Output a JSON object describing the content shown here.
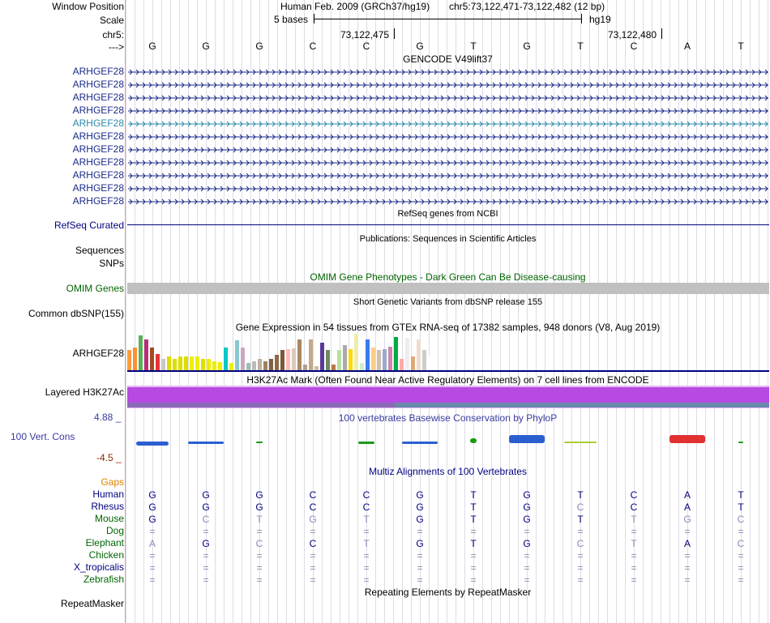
{
  "ruler": {
    "window_position_label": "Window Position",
    "scale_label": "Scale",
    "chr_label": "chr5:",
    "arrow_label": "--->",
    "assembly": "Human Feb. 2009 (GRCh37/hg19)",
    "position": "chr5:73,122,471-73,122,482 (12 bp)",
    "scale_text": "5 bases",
    "db": "hg19",
    "coord1": "73,122,475",
    "coord2": "73,122,480",
    "bases": [
      "G",
      "G",
      "G",
      "C",
      "C",
      "G",
      "T",
      "G",
      "T",
      "C",
      "A",
      "T"
    ]
  },
  "gencode": {
    "title": "GENCODE V49lift37",
    "genes": [
      "ARHGEF28",
      "ARHGEF28",
      "ARHGEF28",
      "ARHGEF28",
      "ARHGEF28",
      "ARHGEF28",
      "ARHGEF28",
      "ARHGEF28",
      "ARHGEF28",
      "ARHGEF28",
      "ARHGEF28"
    ],
    "highlight_index": 4
  },
  "refseq": {
    "title": "RefSeq genes from NCBI",
    "label": "RefSeq Curated"
  },
  "pubs": {
    "title": "Publications: Sequences in Scientific Articles",
    "label1": "Sequences",
    "label2": "SNPs"
  },
  "omim": {
    "title": "OMIM Gene Phenotypes - Dark Green Can Be Disease-causing",
    "label": "OMIM Genes"
  },
  "dbsnp": {
    "title": "Short Genetic Variants from dbSNP release 155",
    "label": "Common dbSNP(155)"
  },
  "gtex": {
    "title": "Gene Expression in 54 tissues from GTEx RNA-seq of 17382 samples, 948 donors (V8, Aug 2019)",
    "label": "ARHGEF28",
    "levels": [
      0.55,
      0.62,
      0.95,
      0.85,
      0.62,
      0.45,
      0.3,
      0.38,
      0.3,
      0.38,
      0.38,
      0.38,
      0.38,
      0.3,
      0.32,
      0.25,
      0.22,
      0.62,
      0.2,
      0.82,
      0.62,
      0.2,
      0.25,
      0.3,
      0.25,
      0.3,
      0.42,
      0.55,
      0.58,
      0.6,
      0.85,
      0.15,
      0.85,
      0.12,
      0.75,
      0.55,
      0.15,
      0.55,
      0.68,
      0.58,
      1.0,
      0.2,
      0.85,
      0.62,
      0.55,
      0.58,
      0.65,
      0.9,
      0.3,
      0.88,
      0.38,
      0.85,
      0.55,
      0.4
    ],
    "colors": [
      "#ff9a3c",
      "#ff8f3a",
      "#58b058",
      "#bb2c7a",
      "#a24a22",
      "#e83333",
      "#c8c8c8",
      "#dddd00",
      "#dddd00",
      "#dddd00",
      "#dddd00",
      "#eeee00",
      "#eeee00",
      "#e0e000",
      "#eeee00",
      "#eeee00",
      "#eeee00",
      "#00c8c8",
      "#eeee00",
      "#88c8cc",
      "#caa7c0",
      "#9abfb0",
      "#bbbbbb",
      "#c0b0a0",
      "#a08060",
      "#806040",
      "#8a6a4a",
      "#7a5a3a",
      "#ffbbbb",
      "#ddc8b8",
      "#aa8866",
      "#b0a090",
      "#c4a888",
      "#ccbcaa",
      "#5a3a9a",
      "#6e8a5e",
      "#bb7744",
      "#b8e0a0",
      "#aaaaaa",
      "#ffd800",
      "#eeeeaa",
      "#cceecc",
      "#3a7aee",
      "#ffcc88",
      "#d0c0b0",
      "#99aacc",
      "#cc88aa",
      "#00aa44",
      "#ffaaaa",
      "#eeeeee",
      "#ddaa77",
      "#eeddcc",
      "#cccccc",
      "#ffffff"
    ]
  },
  "h3k27": {
    "title": "H3K27Ac Mark (Often Found Near Active Regulatory Elements) on 7 cell lines from ENCODE",
    "label": "Layered H3K27Ac"
  },
  "cons": {
    "title": "100 vertebrates Basewise Conservation by PhyloP",
    "label": "100 Vert. Cons",
    "max": "4.88 _",
    "min": "-4.5 _"
  },
  "multiz": {
    "title": "Multiz Alignments of 100 Vertebrates",
    "gaps_label": "Gaps",
    "species": [
      {
        "name": "Human",
        "color": "#000080",
        "bases": [
          "G",
          "G",
          "G",
          "C",
          "C",
          "G",
          "T",
          "G",
          "T",
          "C",
          "A",
          "T"
        ]
      },
      {
        "name": "Rhesus",
        "color": "#000080",
        "bases": [
          "G",
          "G",
          "G",
          "C",
          "C",
          "G",
          "T",
          "G",
          "C",
          "C",
          "A",
          "T"
        ]
      },
      {
        "name": "Mouse",
        "color": "#006400",
        "bases": [
          "G",
          "C",
          "T",
          "G",
          "T",
          "G",
          "T",
          "G",
          "T",
          "T",
          "G",
          "C"
        ]
      },
      {
        "name": "Dog",
        "color": "#006400",
        "bases": [
          "=",
          "=",
          "=",
          "=",
          "=",
          "=",
          "=",
          "=",
          "=",
          "=",
          "=",
          "="
        ]
      },
      {
        "name": "Elephant",
        "color": "#006400",
        "bases": [
          "A",
          "G",
          "C",
          "C",
          "T",
          "G",
          "T",
          "G",
          "C",
          "T",
          "A",
          "C"
        ]
      },
      {
        "name": "Chicken",
        "color": "#006400",
        "bases": [
          "=",
          "=",
          "=",
          "=",
          "=",
          "=",
          "=",
          "=",
          "=",
          "=",
          "=",
          "="
        ]
      },
      {
        "name": "X_tropicalis",
        "color": "#000080",
        "bases": [
          "=",
          "=",
          "=",
          "=",
          "=",
          "=",
          "=",
          "=",
          "=",
          "=",
          "=",
          "="
        ]
      },
      {
        "name": "Zebrafish",
        "color": "#006400",
        "bases": [
          "=",
          "=",
          "=",
          "=",
          "=",
          "=",
          "=",
          "=",
          "=",
          "=",
          "=",
          "="
        ]
      }
    ],
    "dim": [
      [
        false,
        false,
        false,
        false,
        false,
        false,
        false,
        false,
        false,
        false,
        false,
        false
      ],
      [
        false,
        false,
        false,
        false,
        false,
        false,
        false,
        false,
        true,
        false,
        false,
        false
      ],
      [
        false,
        true,
        true,
        true,
        true,
        false,
        false,
        false,
        false,
        true,
        true,
        true
      ],
      [
        true,
        true,
        true,
        true,
        true,
        true,
        true,
        true,
        true,
        true,
        true,
        true
      ],
      [
        true,
        false,
        true,
        false,
        true,
        false,
        false,
        false,
        true,
        true,
        false,
        true
      ],
      [
        true,
        true,
        true,
        true,
        true,
        true,
        true,
        true,
        true,
        true,
        true,
        true
      ],
      [
        true,
        true,
        true,
        true,
        true,
        true,
        true,
        true,
        true,
        true,
        true,
        true
      ],
      [
        true,
        true,
        true,
        true,
        true,
        true,
        true,
        true,
        true,
        true,
        true,
        true
      ]
    ]
  },
  "rmsk": {
    "title": "Repeating Elements by RepeatMasker",
    "label": "RepeatMasker"
  },
  "colors": {
    "label_navy": "#000080",
    "omim_green": "#006400",
    "gaps_orange": "#e08000",
    "gene_blue": "#1a2a88",
    "highlight": "#2a8aaa"
  }
}
